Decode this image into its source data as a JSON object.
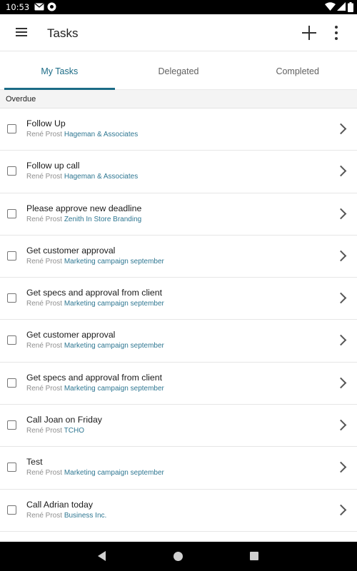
{
  "status_bar": {
    "time": "10:53",
    "icons": [
      "mail-icon",
      "vpn-icon",
      "wifi-icon",
      "cellular-icon",
      "battery-icon"
    ]
  },
  "app_bar": {
    "title": "Tasks",
    "icons": [
      "menu-icon",
      "add-icon",
      "more-vert-icon"
    ]
  },
  "tabs": [
    {
      "label": "My Tasks",
      "active": true
    },
    {
      "label": "Delegated",
      "active": false
    },
    {
      "label": "Completed",
      "active": false
    }
  ],
  "section": {
    "label": "Overdue"
  },
  "tasks": [
    {
      "title": "Follow Up",
      "owner": "René Prost",
      "project": "Hageman & Associates"
    },
    {
      "title": "Follow up call",
      "owner": "René Prost",
      "project": "Hageman & Associates"
    },
    {
      "title": "Please approve new deadline",
      "owner": "René Prost",
      "project": "Zenith In Store Branding"
    },
    {
      "title": "Get customer approval",
      "owner": "René Prost",
      "project": "Marketing campaign september"
    },
    {
      "title": "Get specs and approval from client",
      "owner": "René Prost",
      "project": "Marketing campaign september"
    },
    {
      "title": "Get customer approval",
      "owner": "René Prost",
      "project": "Marketing campaign september"
    },
    {
      "title": "Get specs and approval from client",
      "owner": "René Prost",
      "project": "Marketing campaign september"
    },
    {
      "title": "Call Joan on Friday",
      "owner": "René Prost",
      "project": "TCHO"
    },
    {
      "title": "Test",
      "owner": "René Prost",
      "project": "Marketing campaign september"
    },
    {
      "title": "Call Adrian today",
      "owner": "René Prost",
      "project": "Business Inc."
    }
  ],
  "colors": {
    "accent": "#1b6b86",
    "project_link": "#2f7792"
  }
}
